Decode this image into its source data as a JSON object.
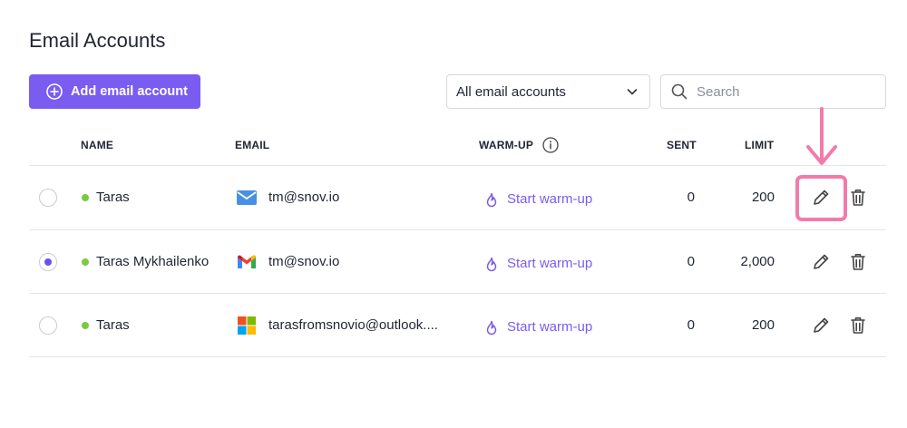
{
  "page": {
    "title": "Email Accounts"
  },
  "toolbar": {
    "add_label": "Add email account",
    "filter_value": "All email accounts",
    "search_placeholder": "Search"
  },
  "table": {
    "headers": {
      "name": "NAME",
      "email": "EMAIL",
      "warmup": "WARM-UP",
      "sent": "SENT",
      "limit": "LIMIT"
    },
    "rows": [
      {
        "name": "Taras",
        "provider": "mail-icon",
        "email": "tm@snov.io",
        "warmup": "Start warm-up",
        "sent": "0",
        "limit": "200",
        "selected": false
      },
      {
        "name": "Taras Mykhailenko",
        "provider": "gmail-icon",
        "email": "tm@snov.io",
        "warmup": "Start warm-up",
        "sent": "0",
        "limit": "2,000",
        "selected": true
      },
      {
        "name": "Taras",
        "provider": "outlook-icon",
        "email": "tarasfromsnovio@outlook....",
        "warmup": "Start warm-up",
        "sent": "0",
        "limit": "200",
        "selected": false
      }
    ]
  },
  "colors": {
    "accent": "#7b5cf0",
    "status_active": "#7ac943",
    "annotation": "#f27bab"
  }
}
